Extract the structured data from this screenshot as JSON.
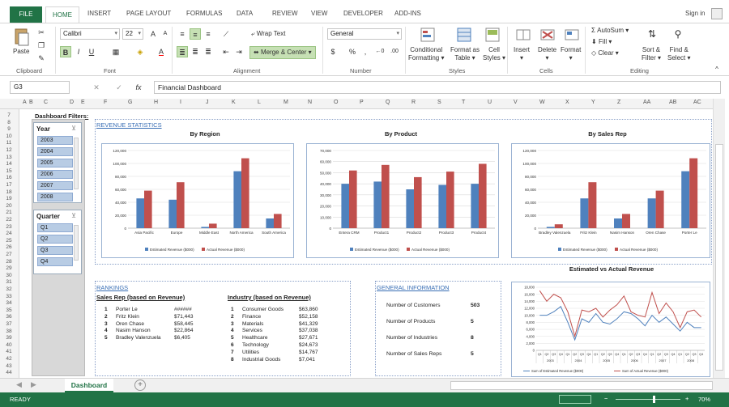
{
  "tabs": [
    "FILE",
    "HOME",
    "INSERT",
    "PAGE LAYOUT",
    "FORMULAS",
    "DATA",
    "REVIEW",
    "VIEW",
    "DEVELOPER",
    "ADD-INS"
  ],
  "sign_in": "Sign in",
  "ribbon": {
    "paste": "Paste",
    "clipboard": "Clipboard",
    "font_name": "Calibri",
    "font_size": "22",
    "font_group": "Font",
    "wrap_text": "Wrap Text",
    "merge_center": "Merge & Center",
    "alignment": "Alignment",
    "number_format": "General",
    "number": "Number",
    "cond_fmt_1": "Conditional",
    "cond_fmt_2": "Formatting",
    "fmt_table_1": "Format as",
    "fmt_table_2": "Table",
    "cell_styles_1": "Cell",
    "cell_styles_2": "Styles",
    "styles": "Styles",
    "insert": "Insert",
    "delete": "Delete",
    "format": "Format",
    "cells": "Cells",
    "autosum": "AutoSum",
    "fill": "Fill",
    "clear": "Clear",
    "sort_1": "Sort &",
    "sort_2": "Filter",
    "find_1": "Find &",
    "find_2": "Select",
    "editing": "Editing"
  },
  "namebox": "G3",
  "formula": "Financial Dashboard",
  "columns": [
    "A",
    "B",
    "C",
    "D",
    "E",
    "F",
    "G",
    "H",
    "I",
    "J",
    "K",
    "L",
    "M",
    "N",
    "O",
    "P",
    "Q",
    "R",
    "S",
    "T",
    "U",
    "V",
    "W",
    "X",
    "Y",
    "Z",
    "AA",
    "AB",
    "AC"
  ],
  "rows": [
    "7",
    "8",
    "9",
    "10",
    "11",
    "12",
    "13",
    "14",
    "15",
    "16",
    "17",
    "18",
    "19",
    "20",
    "21",
    "22",
    "23",
    "24",
    "25",
    "26",
    "27",
    "28",
    "29",
    "30",
    "31",
    "32",
    "33",
    "34",
    "35",
    "36",
    "37",
    "38",
    "39",
    "40",
    "41",
    "42",
    "43",
    "44"
  ],
  "dashboard": {
    "filters_title": "Dashboard Filters:",
    "year_title": "Year",
    "years": [
      "2003",
      "2004",
      "2005",
      "2006",
      "2007",
      "2008"
    ],
    "quarter_title": "Quarter",
    "quarters": [
      "Q1",
      "Q2",
      "Q3",
      "Q4"
    ],
    "revenue_stats": "REVENUE STATISTICS",
    "rankings": "RANKINGS",
    "general_info": "GENERAL INFORMATION",
    "salesrep_hdr": "Sales Rep (based on Revenue)",
    "industry_hdr": "Industry (based on Revenue)",
    "salesrep_rank": [
      {
        "n": "1",
        "name": "Porter Le",
        "val": "######"
      },
      {
        "n": "2",
        "name": "Fritz Klein",
        "val": "$71,443"
      },
      {
        "n": "3",
        "name": "Oren Chase",
        "val": "$58,445"
      },
      {
        "n": "4",
        "name": "Nasim Hanson",
        "val": "$22,864"
      },
      {
        "n": "5",
        "name": "Bradley Valenzuela",
        "val": "$6,405"
      }
    ],
    "industry_rank": [
      {
        "n": "1",
        "name": "Consumer Goods",
        "val": "$63,860"
      },
      {
        "n": "2",
        "name": "Finance",
        "val": "$52,158"
      },
      {
        "n": "3",
        "name": "Materials",
        "val": "$41,329"
      },
      {
        "n": "4",
        "name": "Services",
        "val": "$37,038"
      },
      {
        "n": "5",
        "name": "Healthcare",
        "val": "$27,671"
      },
      {
        "n": "6",
        "name": "Technology",
        "val": "$24,673"
      },
      {
        "n": "7",
        "name": "Utilities",
        "val": "$14,767"
      },
      {
        "n": "8",
        "name": "Industrial Goods",
        "val": "$7,041"
      }
    ],
    "info": [
      {
        "label": "Number of Customers",
        "val": "503"
      },
      {
        "label": "Number of Products",
        "val": "5"
      },
      {
        "label": "Number of Industries",
        "val": "8"
      },
      {
        "label": "Number of Sales Reps",
        "val": "5"
      }
    ]
  },
  "sheet_tab": "Dashboard",
  "status": {
    "ready": "READY",
    "zoom": "70%"
  },
  "colors": {
    "estimated": "#4f81bd",
    "actual": "#c0504d",
    "excel_green": "#217346"
  },
  "chart_data": [
    {
      "type": "bar",
      "title": "By Region",
      "categories": [
        "Asia Pacific",
        "Europe",
        "Middle East",
        "North America",
        "South America"
      ],
      "series": [
        {
          "name": "Estimated Revenue ($000)",
          "values": [
            46000,
            44000,
            2000,
            88000,
            15000
          ]
        },
        {
          "name": "Actual Revenue ($000)",
          "values": [
            58000,
            71000,
            7000,
            108000,
            22000
          ]
        }
      ],
      "ylim": [
        0,
        120000
      ],
      "yticks": [
        "0",
        "20,000",
        "40,000",
        "60,000",
        "80,000",
        "100,000",
        "120,000"
      ],
      "ytick_values": [
        0,
        20000,
        40000,
        60000,
        80000,
        100000,
        120000
      ]
    },
    {
      "type": "bar",
      "title": "By Product",
      "categories": [
        "Entera CRM",
        "Product1",
        "Product2",
        "Product3",
        "Product4"
      ],
      "series": [
        {
          "name": "Estimated Revenue ($000)",
          "values": [
            40000,
            42000,
            35000,
            39000,
            40000
          ]
        },
        {
          "name": "Actual Revenue ($000)",
          "values": [
            52000,
            57000,
            46000,
            51000,
            58000
          ]
        }
      ],
      "ylim": [
        0,
        70000
      ],
      "yticks": [
        "0",
        "10,000",
        "20,000",
        "30,000",
        "40,000",
        "50,000",
        "60,000",
        "70,000"
      ],
      "ytick_values": [
        0,
        10000,
        20000,
        30000,
        40000,
        50000,
        60000,
        70000
      ]
    },
    {
      "type": "bar",
      "title": "By Sales Rep",
      "categories": [
        "Bradley Valenzuela",
        "Fritz Klein",
        "Nasim Hanson",
        "Oren Chase",
        "Porter Le"
      ],
      "series": [
        {
          "name": "Estimated Revenue ($000)",
          "values": [
            2000,
            46000,
            15000,
            46000,
            88000
          ]
        },
        {
          "name": "Actual Revenue ($000)",
          "values": [
            6000,
            71000,
            22000,
            58000,
            108000
          ]
        }
      ],
      "ylim": [
        0,
        120000
      ],
      "yticks": [
        "0",
        "20,000",
        "40,000",
        "60,000",
        "80,000",
        "100,000",
        "120,000"
      ],
      "ytick_values": [
        0,
        20000,
        40000,
        60000,
        80000,
        100000,
        120000
      ]
    },
    {
      "type": "line",
      "title": "Estimated vs Actual Revenue",
      "x": [
        "Q1",
        "Q2",
        "Q3",
        "Q4",
        "Q1",
        "Q2",
        "Q3",
        "Q4",
        "Q1",
        "Q2",
        "Q3",
        "Q4",
        "Q1",
        "Q2",
        "Q3",
        "Q4",
        "Q1",
        "Q2",
        "Q3",
        "Q4",
        "Q1",
        "Q2",
        "Q3",
        "Q4"
      ],
      "years": [
        "2003",
        "2004",
        "2005",
        "2006",
        "2007",
        "2008"
      ],
      "series": [
        {
          "name": "Sum of Estimated Revenue ($000)",
          "values": [
            10000,
            10000,
            11000,
            12500,
            8000,
            3000,
            9000,
            8000,
            10500,
            8000,
            7500,
            9000,
            11000,
            10500,
            9000,
            7000,
            10000,
            8000,
            9500,
            7500,
            5500,
            8000,
            6500,
            6500
          ]
        },
        {
          "name": "Sum of Actual Revenue ($000)",
          "values": [
            17000,
            14000,
            16000,
            15000,
            11000,
            4000,
            11500,
            11000,
            12000,
            9500,
            11500,
            13000,
            15500,
            11000,
            10000,
            9500,
            16500,
            10500,
            13500,
            11000,
            6500,
            11000,
            11500,
            9500
          ]
        }
      ],
      "ylim": [
        0,
        18000
      ],
      "yticks": [
        "0",
        "2,000",
        "4,000",
        "6,000",
        "8,000",
        "10,000",
        "12,000",
        "14,000",
        "16,000",
        "18,000"
      ],
      "ytick_values": [
        0,
        2000,
        4000,
        6000,
        8000,
        10000,
        12000,
        14000,
        16000,
        18000
      ]
    }
  ]
}
